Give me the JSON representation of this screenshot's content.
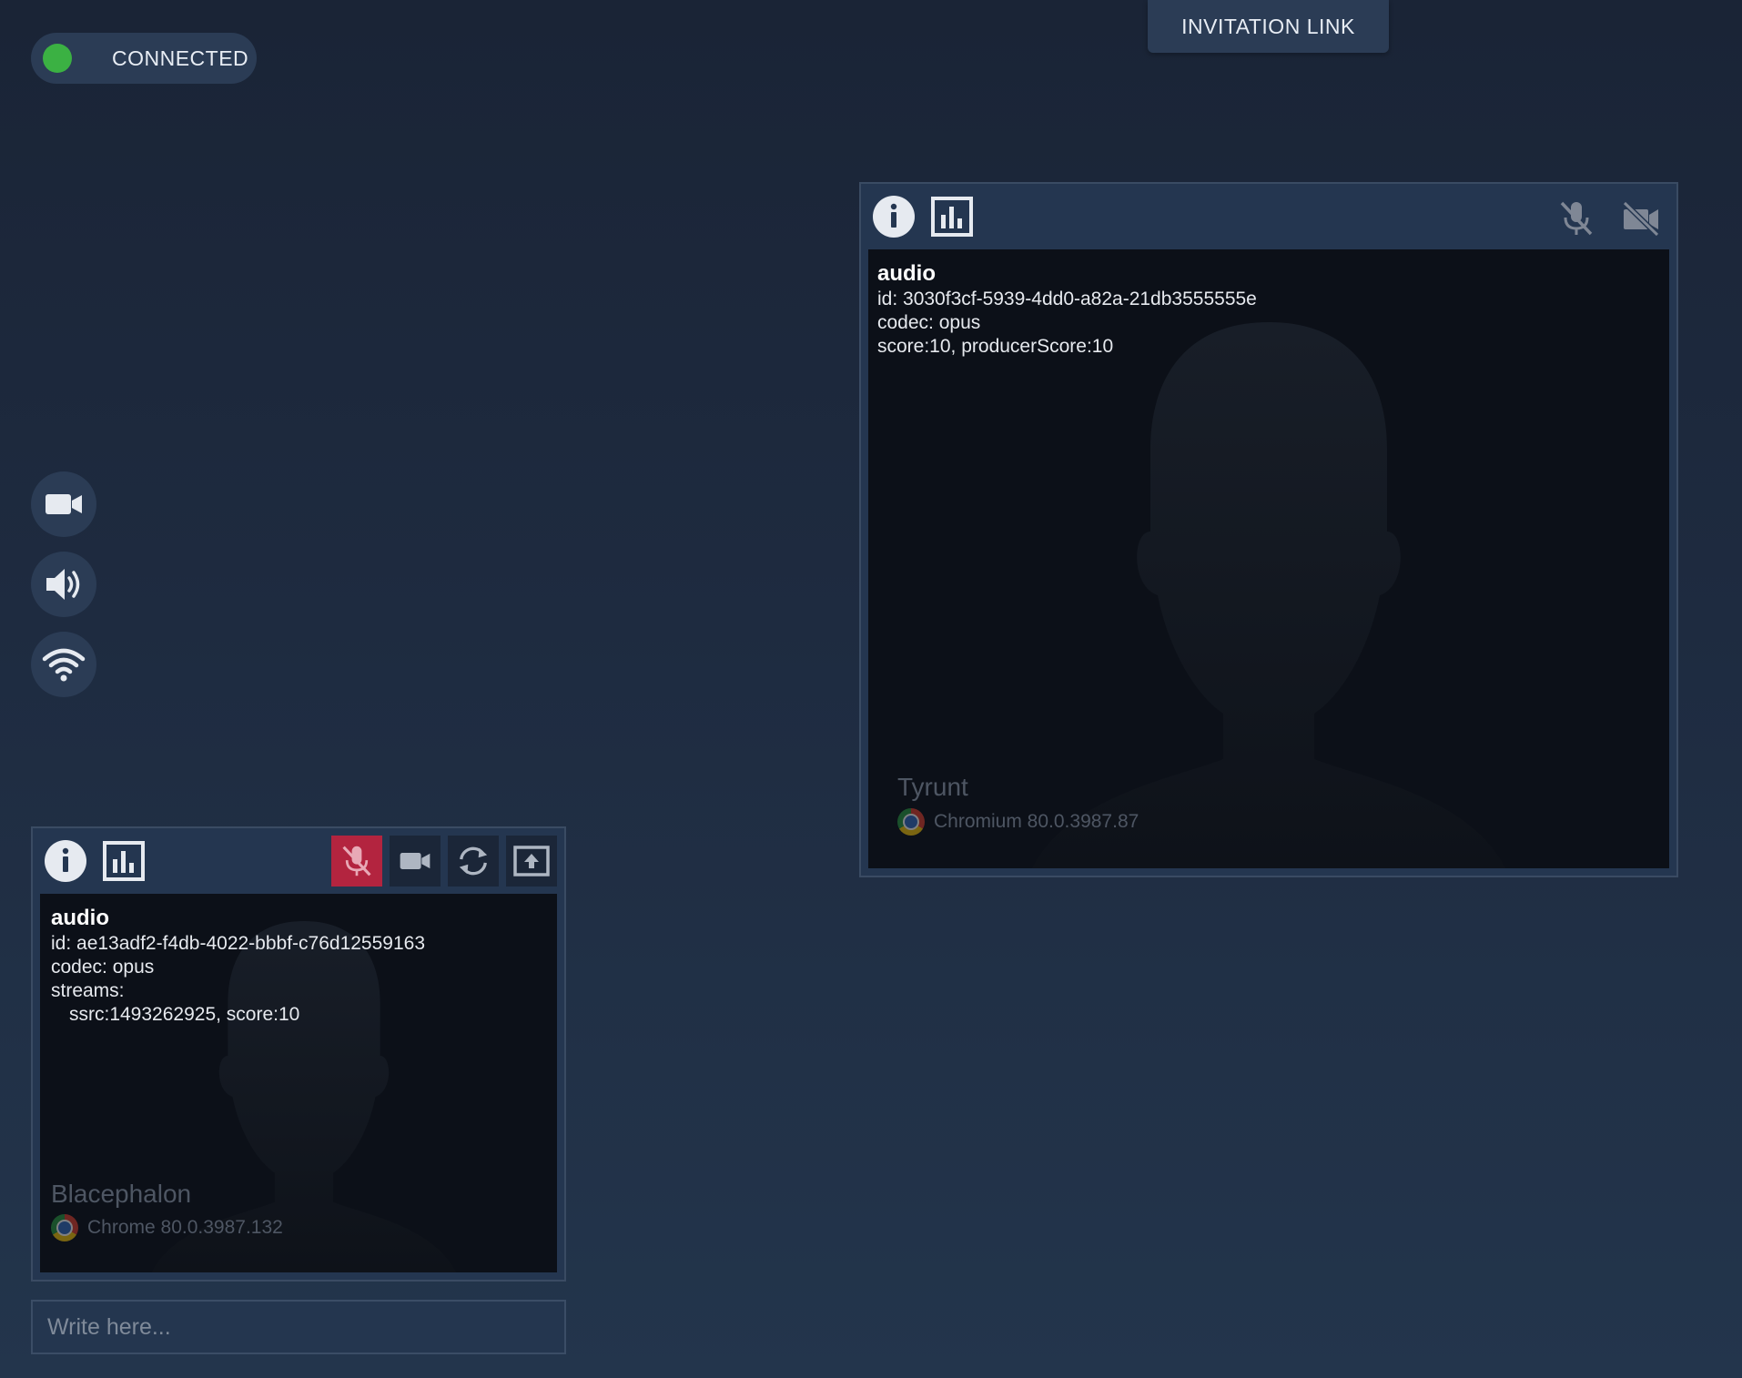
{
  "connection": {
    "label": "CONNECTED",
    "status_color": "#3bb143"
  },
  "invitation": {
    "label": "INVITATION LINK"
  },
  "side_controls": [
    {
      "icon": "camera-icon"
    },
    {
      "icon": "speaker-icon"
    },
    {
      "icon": "wifi-icon"
    }
  ],
  "remote_peer": {
    "info": {
      "title": "audio",
      "id_line": "id: 3030f3cf-5939-4dd0-a82a-21db3555555e",
      "codec_line": "codec: opus",
      "score_line": "score:10, producerScore:10"
    },
    "name": "Tyrunt",
    "device": "Chromium 80.0.3987.87",
    "toolbar": {
      "left_icons": [
        "info-icon",
        "stats-icon"
      ],
      "right_icons": [
        "mic-off-icon",
        "video-off-icon"
      ]
    }
  },
  "local_peer": {
    "info": {
      "title": "audio",
      "id_line": "id: ae13adf2-f4db-4022-bbbf-c76d12559163",
      "codec_line": "codec: opus",
      "streams_label": "streams:",
      "stream_line": "ssrc:1493262925, score:10"
    },
    "name": "Blacephalon",
    "device": "Chrome 80.0.3987.132",
    "toolbar": {
      "left_icons": [
        "info-icon",
        "stats-icon"
      ],
      "right_icons": [
        "mic-muted-icon",
        "webcam-icon",
        "change-webcam-icon",
        "share-screen-icon"
      ],
      "muted_color": "#b3243f"
    }
  },
  "chat": {
    "placeholder": "Write here..."
  }
}
